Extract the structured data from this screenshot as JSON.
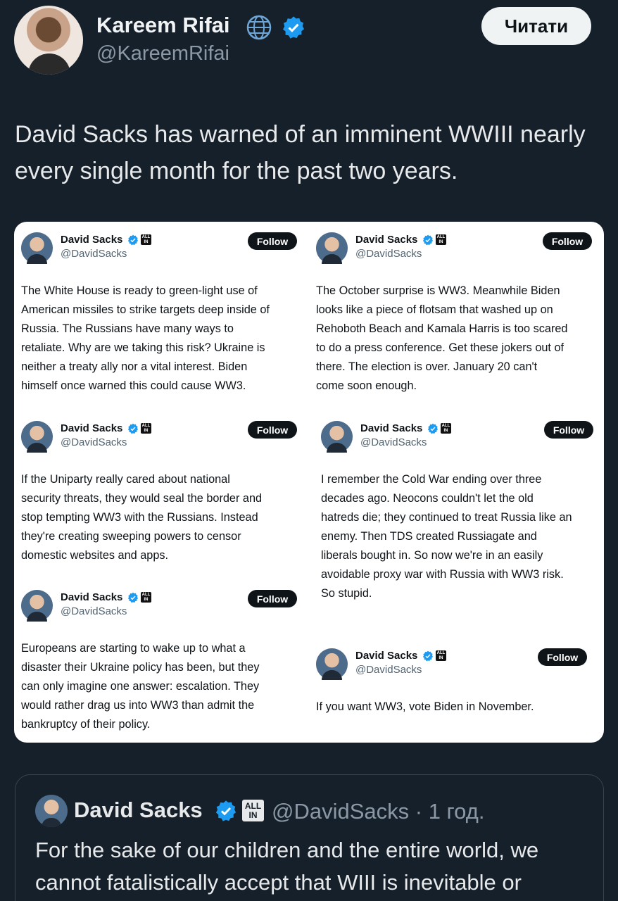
{
  "tweet": {
    "author_name": "Kareem Rifai",
    "author_handle": "@KareemRifai",
    "follow_label": "Читати",
    "text": "David Sacks has warned of an imminent WWIII nearly every single month for the past two years."
  },
  "collage": {
    "cards": [
      {
        "name": "David Sacks",
        "handle": "@DavidSacks",
        "follow": "Follow",
        "text": [
          "The White House is ready to green-light use of",
          "American missiles to strike targets deep inside of",
          "Russia. The Russians have many ways to",
          "retaliate. Why are we taking this risk? Ukraine is",
          "neither a treaty ally nor a vital interest. Biden",
          "himself once warned this could cause WW3."
        ]
      },
      {
        "name": "David Sacks",
        "handle": "@DavidSacks",
        "follow": "Follow",
        "text": [
          "The October surprise is WW3. Meanwhile Biden",
          "looks like a piece of flotsam that washed up on",
          "Rehoboth Beach and Kamala Harris is too scared",
          "to do a press conference. Get these jokers out of",
          "there. The election is over. January 20 can't",
          "come soon enough."
        ]
      },
      {
        "name": "David Sacks",
        "handle": "@DavidSacks",
        "follow": "Follow",
        "text": [
          "If the Uniparty really cared about national",
          "security threats, they would seal the border and",
          "stop tempting WW3 with the Russians. Instead",
          "they're creating sweeping powers to censor",
          "domestic websites and apps."
        ]
      },
      {
        "name": "David Sacks",
        "handle": "@DavidSacks",
        "follow": "Follow",
        "text": [
          "I remember the Cold War ending over three",
          "decades ago. Neocons couldn't let the old",
          "hatreds die; they continued to treat Russia like an",
          "enemy. Then TDS created Russiagate and",
          "liberals bought in. So now we're in an easily",
          "avoidable proxy war with Russia with WW3 risk.",
          "So stupid."
        ]
      },
      {
        "name": "David Sacks",
        "handle": "@DavidSacks",
        "follow": "Follow",
        "text": [
          "Europeans are starting to wake up to what a",
          "disaster their Ukraine policy has been, but they",
          "can only imagine one answer: escalation. They",
          "would rather drag us into WW3 than admit the",
          "bankruptcy of their policy."
        ]
      },
      {
        "name": "David Sacks",
        "handle": "@DavidSacks",
        "follow": "Follow",
        "text": [
          "If you want WW3, vote Biden in November."
        ]
      }
    ],
    "badge_text": "ALL IN"
  },
  "quote": {
    "name": "David Sacks",
    "badge": "ALL IN",
    "handle_time": "@DavidSacks · 1 год.",
    "text": "For the sake of our children and the entire world, we cannot fatalistically accept that WIII is inevitable or"
  },
  "colors": {
    "background": "#15202b",
    "verified": "#1d9bf0"
  }
}
